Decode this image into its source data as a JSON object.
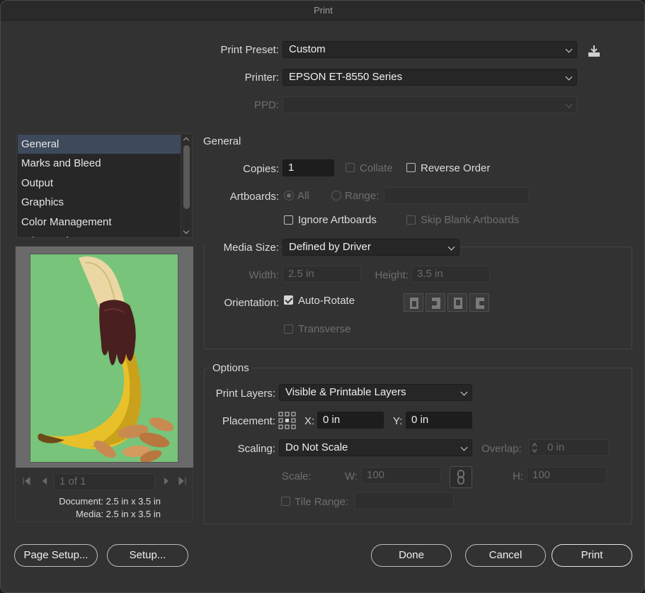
{
  "window": {
    "title": "Print"
  },
  "top": {
    "preset_label": "Print Preset:",
    "preset_value": "Custom",
    "printer_label": "Printer:",
    "printer_value": "EPSON ET-8550 Series",
    "ppd_label": "PPD:",
    "ppd_value": ""
  },
  "sidebar": {
    "items": [
      {
        "label": "General"
      },
      {
        "label": "Marks and Bleed"
      },
      {
        "label": "Output"
      },
      {
        "label": "Graphics"
      },
      {
        "label": "Color Management"
      },
      {
        "label": "Advanced"
      }
    ],
    "selected": "General"
  },
  "preview": {
    "page_field": "1 of 1",
    "document_info": "Document: 2.5 in x 3.5 in",
    "media_info": "Media: 2.5 in x 3.5 in"
  },
  "general": {
    "heading": "General",
    "copies_label": "Copies:",
    "copies_value": "1",
    "collate_label": "Collate",
    "reverse_label": "Reverse Order",
    "artboards_label": "Artboards:",
    "all_label": "All",
    "range_label": "Range:",
    "range_value": "",
    "ignore_artboards_label": "Ignore Artboards",
    "skip_blank_label": "Skip Blank Artboards"
  },
  "media": {
    "size_label": "Media Size:",
    "size_value": "Defined by Driver",
    "width_label": "Width:",
    "width_value": "2.5 in",
    "height_label": "Height:",
    "height_value": "3.5 in",
    "orientation_label": "Orientation:",
    "auto_rotate_label": "Auto-Rotate",
    "transverse_label": "Transverse"
  },
  "options": {
    "heading": "Options",
    "print_layers_label": "Print Layers:",
    "print_layers_value": "Visible & Printable Layers",
    "placement_label": "Placement:",
    "x_label": "X:",
    "x_value": "0 in",
    "y_label": "Y:",
    "y_value": "0 in",
    "scaling_label": "Scaling:",
    "scaling_value": "Do Not Scale",
    "overlap_label": "Overlap:",
    "overlap_value": "0 in",
    "scale_label": "Scale:",
    "w_label": "W:",
    "w_value": "100",
    "h_label": "H:",
    "h_value": "100",
    "tile_range_label": "Tile Range:",
    "tile_range_value": ""
  },
  "buttons": {
    "page_setup": "Page Setup...",
    "setup": "Setup...",
    "done": "Done",
    "cancel": "Cancel",
    "print": "Print"
  },
  "icons": {
    "save_preset": "save-preset-icon",
    "link_scale": "chain-link-icon",
    "placement": "placement-grid-icon"
  }
}
